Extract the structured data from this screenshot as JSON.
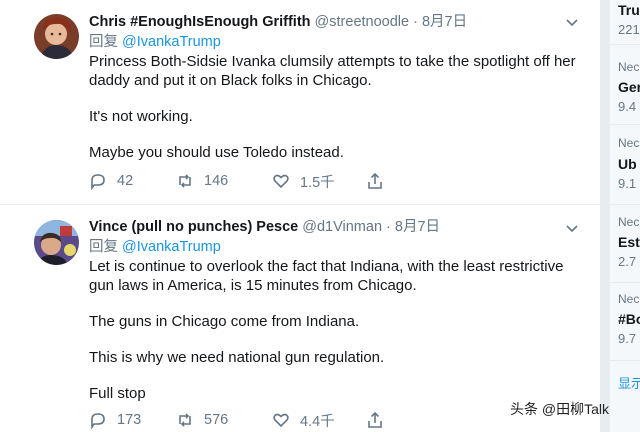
{
  "tweets": [
    {
      "name": "Chris #EnoughIsEnough Griffith",
      "handle": "@streetnoodle",
      "dot": "·",
      "date": "8月7日",
      "reply_prefix": "回复",
      "reply_to": "@IvankaTrump",
      "paragraphs": [
        "Princess Both-Sidsie Ivanka clumsily attempts to take the spotlight off her daddy and put it on Black folks in Chicago.",
        "It's not working.",
        "Maybe you should use Toledo instead."
      ],
      "replies": "42",
      "retweets": "146",
      "likes": "1.5千"
    },
    {
      "name": "Vince (pull no punches) Pesce",
      "handle": "@d1Vinman",
      "dot": "·",
      "date": "8月7日",
      "reply_prefix": "回复",
      "reply_to": "@IvankaTrump",
      "paragraphs": [
        "Let is continue to overlook the fact that Indiana, with the least restrictive gun laws in America, is 15 minutes from Chicago.",
        "The guns in Chicago come from Indiana.",
        "This is why we need national gun regulation.",
        "Full stop"
      ],
      "replies": "173",
      "retweets": "576",
      "likes": "4.4千"
    }
  ],
  "sidebar": {
    "items": [
      {
        "kicker": "",
        "title": "Tru",
        "count": "221"
      },
      {
        "kicker": "Nec",
        "title": "Ger",
        "count": "9.4"
      },
      {
        "kicker": "Nec",
        "title": "Ub",
        "count": "9.1"
      },
      {
        "kicker": "Nec",
        "title": "Est",
        "count": "2.7"
      },
      {
        "kicker": "Nec",
        "title": "#Bo",
        "count": "9.7"
      }
    ],
    "show_more": "显示"
  },
  "watermark": "头条 @田柳Talk",
  "icons": {
    "reply": "reply-icon",
    "retweet": "retweet-icon",
    "like": "heart-icon",
    "share": "share-icon",
    "caret": "chevron-down-icon"
  },
  "colors": {
    "link": "#1b95e0",
    "muted": "#657786",
    "text": "#14171a",
    "border": "#e6ecf0"
  }
}
